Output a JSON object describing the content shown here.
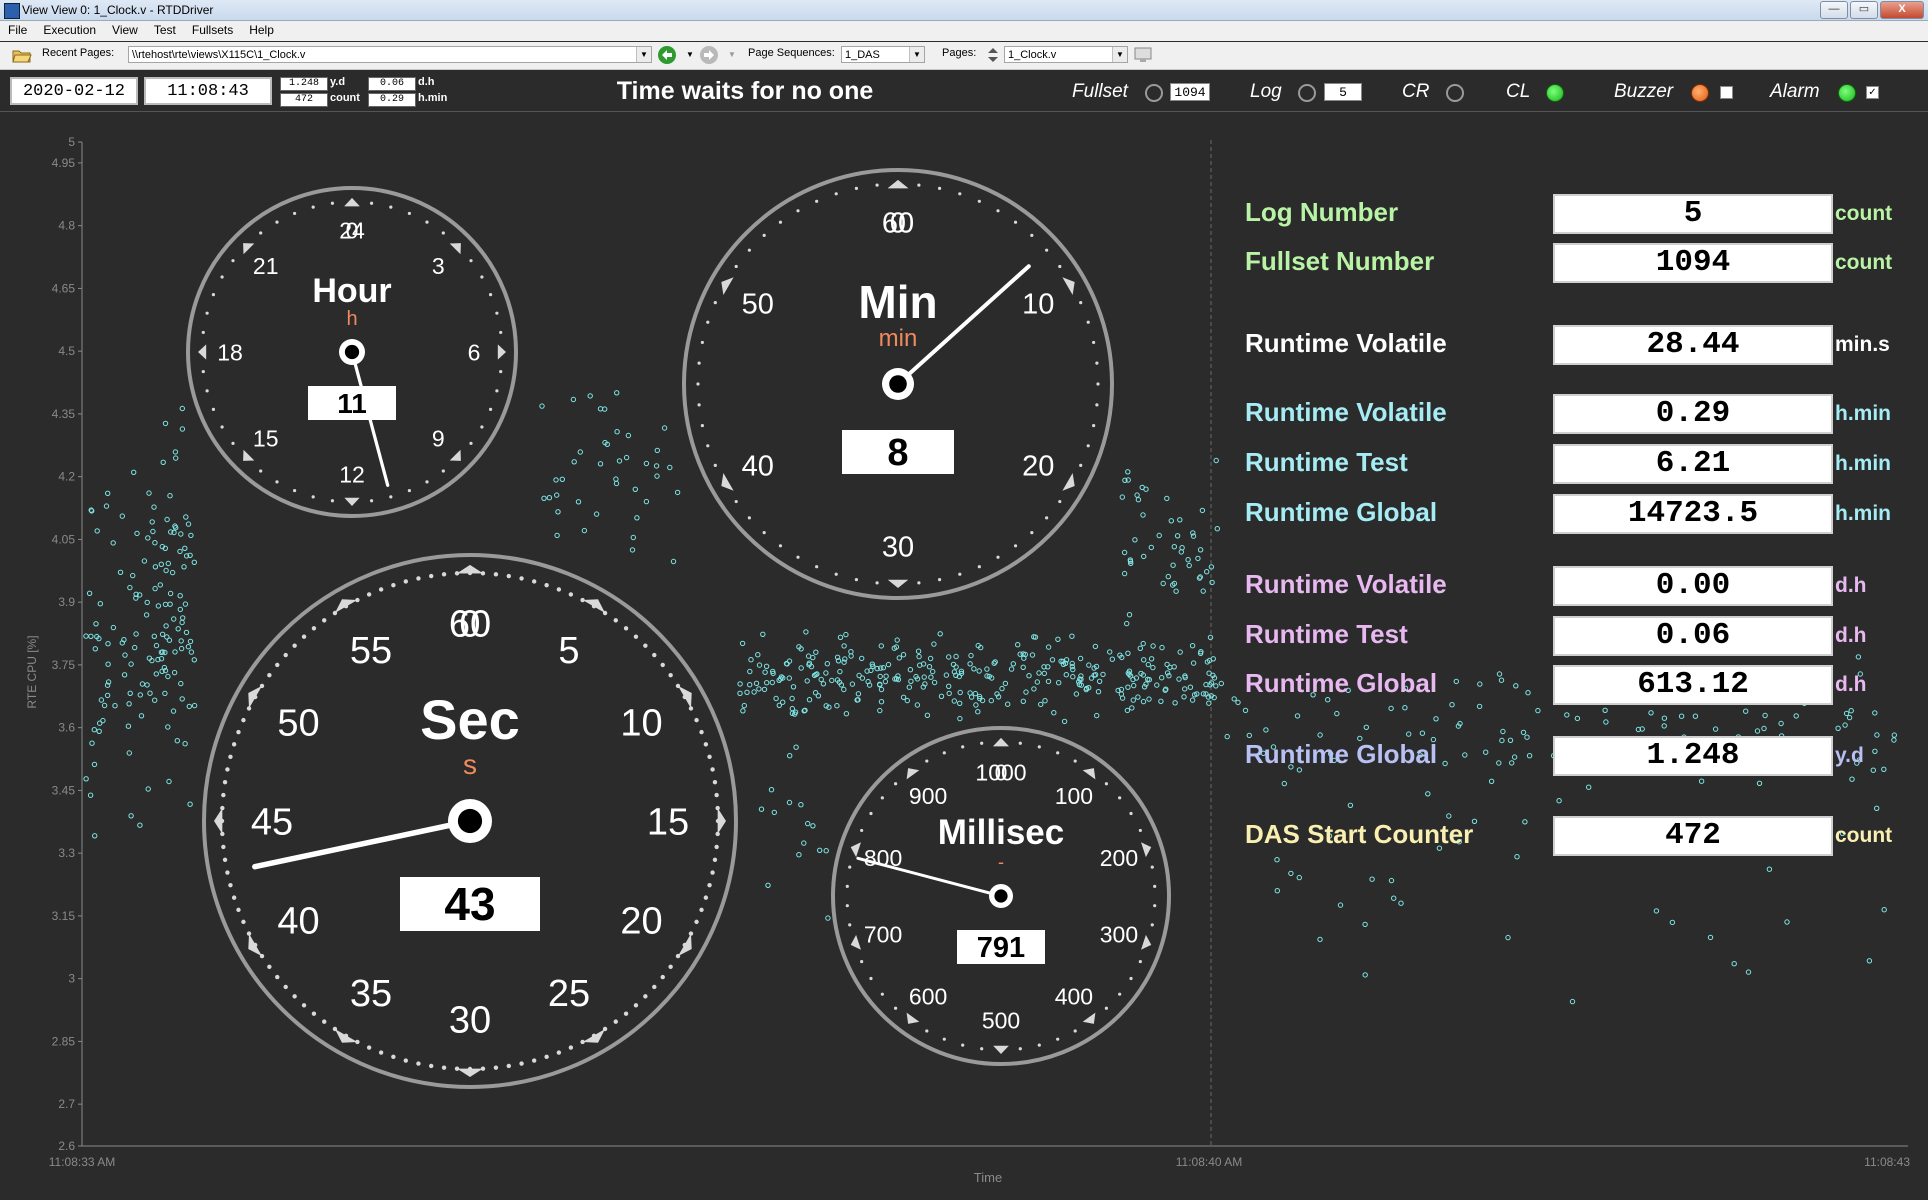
{
  "window": {
    "title": "View View 0: 1_Clock.v - RTDDriver",
    "min_label": "—",
    "max_label": "▭",
    "close_label": "X"
  },
  "menu": [
    "File",
    "Execution",
    "View",
    "Test",
    "Fullsets",
    "Help"
  ],
  "toolbar": {
    "recent_label": "Recent Pages:",
    "recent_value": "\\\\rtehost\\rte\\views\\X115C\\1_Clock.v",
    "seq_label": "Page Sequences:",
    "seq_value": "1_DAS",
    "pages_label": "Pages:",
    "pages_value": "1_Clock.v"
  },
  "status": {
    "date": "2020-02-12",
    "time": "11:08:43",
    "mini": [
      {
        "value": "1.248",
        "unit": "y.d"
      },
      {
        "value": "472",
        "unit": "count"
      },
      {
        "value": "0.06",
        "unit": "d.h"
      },
      {
        "value": "0.29",
        "unit": "h.min"
      }
    ],
    "slogan": "Time waits for no one",
    "indicators": [
      {
        "label": "Fullset",
        "state": "off",
        "value": "1094"
      },
      {
        "label": "Log",
        "state": "off",
        "value": "5"
      },
      {
        "label": "CR",
        "state": "off"
      },
      {
        "label": "CL",
        "state": "on",
        "color": "#22c722"
      },
      {
        "label": "Buzzer",
        "state": "on",
        "color": "#f26a1b",
        "check": ""
      },
      {
        "label": "Alarm",
        "state": "on",
        "color": "#22c722",
        "check": "✓"
      }
    ]
  },
  "plot": {
    "ylabel": "RTE CPU [%]",
    "xlabel": "Time",
    "y_ticks": [
      "5",
      "4.95",
      "4.8",
      "4.65",
      "4.5",
      "4.35",
      "4.2",
      "4.05",
      "3.9",
      "3.75",
      "3.6",
      "3.45",
      "3.3",
      "3.15",
      "3",
      "2.85",
      "2.7",
      "2.6"
    ],
    "x_ticks": [
      "11:08:33 AM",
      "11:08:40 AM",
      "11:08:43"
    ],
    "dot_color": "#7fe5e5"
  },
  "gauges": {
    "hour": {
      "title": "Hour",
      "unit": "h",
      "readout": "11",
      "value": 11,
      "ticks": [
        "0",
        "3",
        "6",
        "9",
        "12",
        "15",
        "18",
        "21",
        "24"
      ]
    },
    "min": {
      "title": "Min",
      "unit": "min",
      "readout": "8",
      "value": 8,
      "ticks": [
        "0",
        "10",
        "20",
        "30",
        "40",
        "50",
        "60"
      ]
    },
    "sec": {
      "title": "Sec",
      "unit": "s",
      "readout": "43",
      "value": 43,
      "ticks": [
        "0",
        "5",
        "10",
        "15",
        "20",
        "25",
        "30",
        "35",
        "40",
        "45",
        "50",
        "55",
        "60"
      ]
    },
    "ms": {
      "title": "Millisec",
      "unit": "-",
      "readout": "791",
      "value": 791,
      "ticks": [
        "0",
        "100",
        "200",
        "300",
        "400",
        "500",
        "600",
        "700",
        "800",
        "900",
        "1000"
      ]
    },
    "label_color": "#f08a5d"
  },
  "readouts": [
    {
      "label": "Log Number",
      "value": "5",
      "unit": "count",
      "color": "#b9f4a6"
    },
    {
      "label": "Fullset Number",
      "value": "1094",
      "unit": "count",
      "color": "#b9f4a6"
    },
    {
      "label": "Runtime Volatile",
      "value": "28.44",
      "unit": "min.s",
      "color": "#ffffff"
    },
    {
      "label": "Runtime Volatile",
      "value": "0.29",
      "unit": "h.min",
      "color": "#a6ecf4"
    },
    {
      "label": "Runtime Test",
      "value": "6.21",
      "unit": "h.min",
      "color": "#a6ecf4"
    },
    {
      "label": "Runtime Global",
      "value": "14723.5",
      "unit": "h.min",
      "color": "#a6ecf4"
    },
    {
      "label": "Runtime Volatile",
      "value": "0.00",
      "unit": "d.h",
      "color": "#e8b8f0"
    },
    {
      "label": "Runtime Test",
      "value": "0.06",
      "unit": "d.h",
      "color": "#e8b8f0"
    },
    {
      "label": "Runtime Global",
      "value": "613.12",
      "unit": "d.h",
      "color": "#e8b8f0"
    },
    {
      "label": "Runtime Global",
      "value": "1.248",
      "unit": "y.d",
      "color": "#b8c0f4"
    },
    {
      "label": "DAS Start Counter",
      "value": "472",
      "unit": "count",
      "color": "#f8efb0"
    }
  ]
}
